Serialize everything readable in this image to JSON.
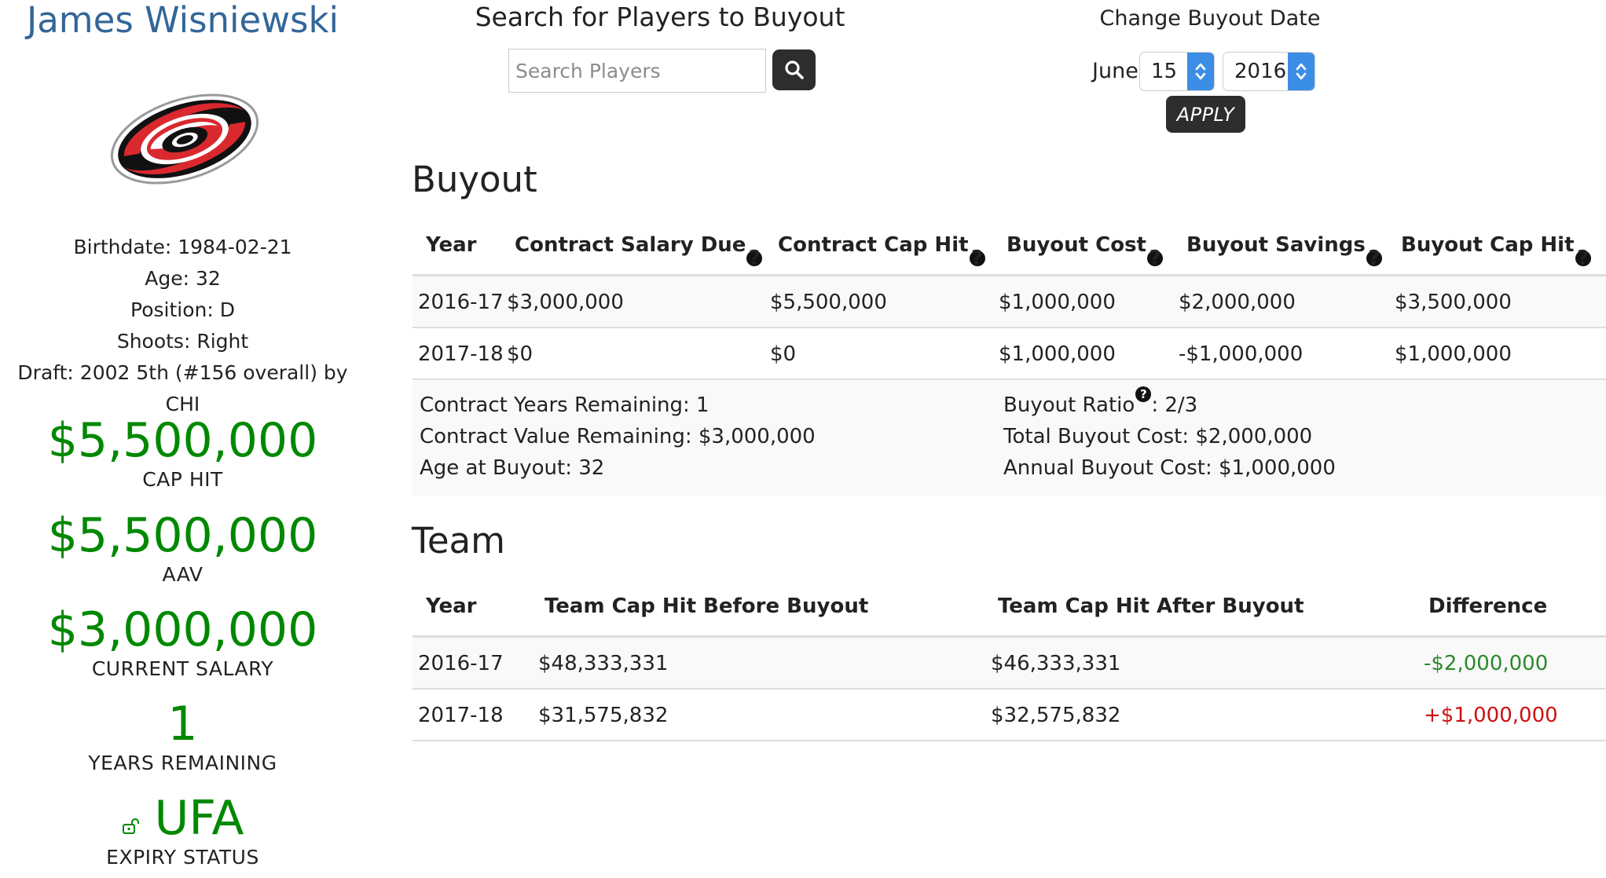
{
  "player": {
    "name": "James Wisniewski",
    "birthdate": "Birthdate: 1984-02-21",
    "age": "Age: 32",
    "position": "Position: D",
    "shoots": "Shoots: Right",
    "draft": "Draft: 2002 5th (#156 overall) by CHI",
    "team_logo_icon": "hurricanes-logo-icon"
  },
  "stats": {
    "cap_hit": {
      "value": "$5,500,000",
      "label": "CAP HIT"
    },
    "aav": {
      "value": "$5,500,000",
      "label": "AAV"
    },
    "current_salary": {
      "value": "$3,000,000",
      "label": "CURRENT SALARY"
    },
    "years_remaining": {
      "value": "1",
      "label": "YEARS REMAINING"
    },
    "expiry": {
      "value": "UFA",
      "label": "EXPIRY STATUS",
      "icon": "unlock-icon"
    }
  },
  "search": {
    "title": "Search for Players to Buyout",
    "placeholder": "Search Players",
    "button_icon": "search-icon"
  },
  "date": {
    "title": "Change Buyout Date",
    "month": "June",
    "day": "15",
    "year": "2016",
    "apply_label": "APPLY"
  },
  "buyout": {
    "title": "Buyout",
    "headers": [
      "Year",
      "Contract Salary Due",
      "Contract Cap Hit",
      "Buyout Cost",
      "Buyout Savings",
      "Buyout Cap Hit"
    ],
    "rows": [
      [
        "2016-17",
        "$3,000,000",
        "$5,500,000",
        "$1,000,000",
        "$2,000,000",
        "$3,500,000"
      ],
      [
        "2017-18",
        "$0",
        "$0",
        "$1,000,000",
        "-$1,000,000",
        "$1,000,000"
      ]
    ],
    "summary": {
      "years_remaining": "Contract Years Remaining: 1",
      "value_remaining": "Contract Value Remaining: $3,000,000",
      "age_at_buyout": "Age at Buyout: 32",
      "ratio_label": "Buyout Ratio",
      "ratio_value": ": 2/3",
      "total_cost": "Total Buyout Cost: $2,000,000",
      "annual_cost": "Annual Buyout Cost: $1,000,000"
    }
  },
  "team": {
    "title": "Team",
    "headers": [
      "Year",
      "Team Cap Hit Before Buyout",
      "Team Cap Hit After Buyout",
      "Difference"
    ],
    "rows": [
      [
        "2016-17",
        "$48,333,331",
        "$46,333,331",
        "-$2,000,000"
      ],
      [
        "2017-18",
        "$31,575,832",
        "$32,575,832",
        "+$1,000,000"
      ]
    ]
  },
  "colors": {
    "name_blue": "#336699",
    "stat_green": "#008800",
    "negative_green": "#2a8a2a",
    "positive_red": "#cc1111",
    "select_blue": "#3a8ee6",
    "dark_button": "#2d2d2d"
  }
}
